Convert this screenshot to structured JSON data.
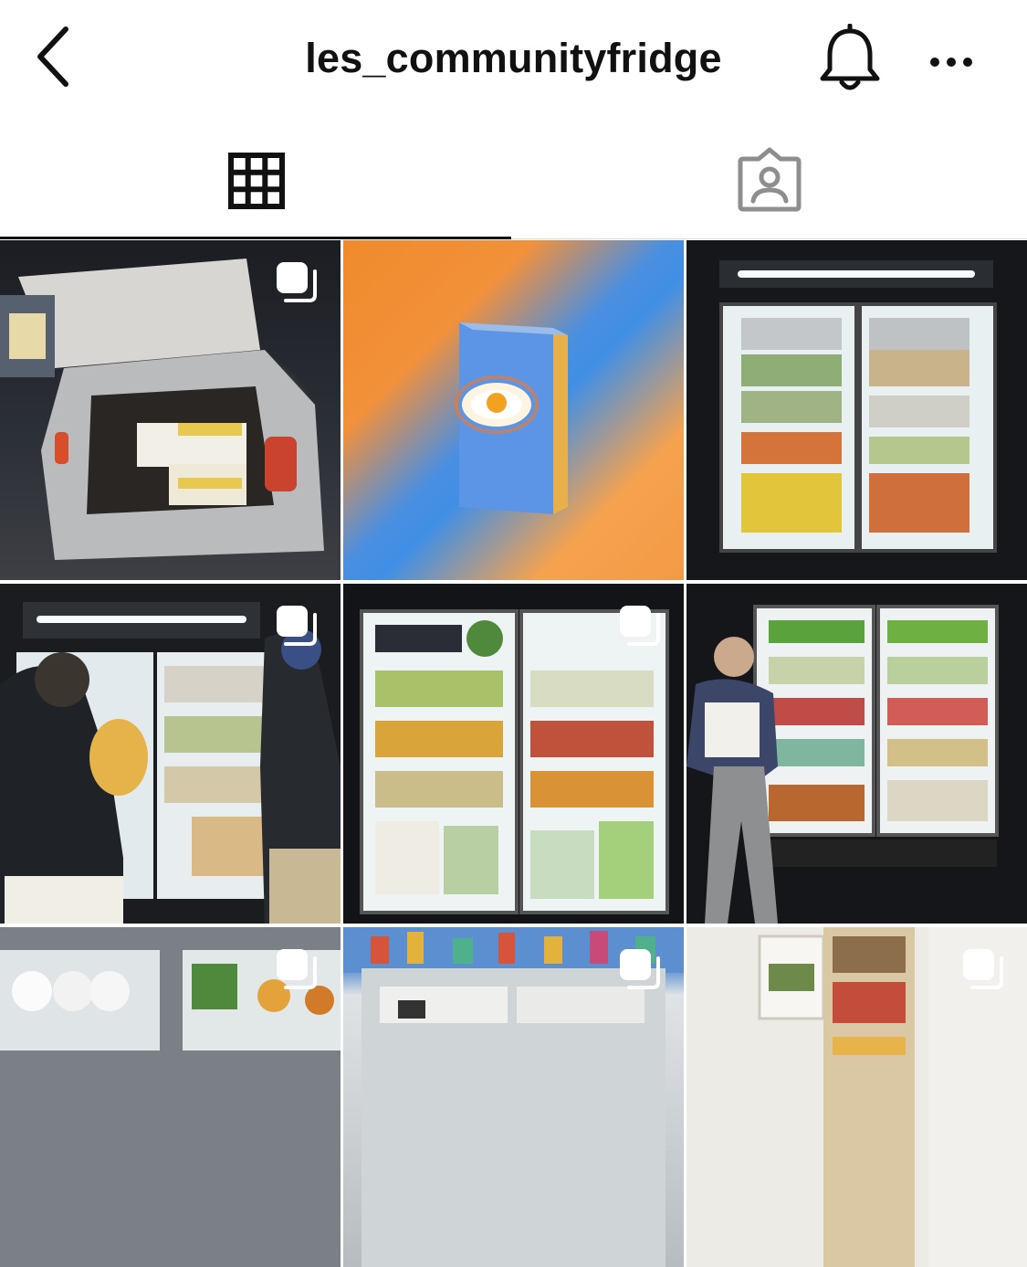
{
  "header": {
    "username": "les_communityfridge",
    "back_icon": "chevron-left-icon",
    "notification_icon": "bell-icon",
    "more_icon": "ellipsis-icon"
  },
  "tabs": [
    {
      "name": "posts",
      "icon": "grid-icon",
      "active": true
    },
    {
      "name": "tagged",
      "icon": "tagged-person-icon",
      "active": false
    }
  ],
  "posts": [
    {
      "subject": "car trunk loaded with banana boxes",
      "multiple": true
    },
    {
      "subject": "book with fried egg cover on gradient",
      "multiple": false
    },
    {
      "subject": "stocked community fridge at night",
      "multiple": false
    },
    {
      "subject": "volunteers with turkey at fridge",
      "multiple": true
    },
    {
      "subject": "fully stocked double-door fridge",
      "multiple": true
    },
    {
      "subject": "volunteer pointing at stocked fridge",
      "multiple": false
    },
    {
      "subject": "fridge with paper towels and produce",
      "multiple": true
    },
    {
      "subject": "fridge under colorful mural",
      "multiple": true
    },
    {
      "subject": "open shelving with produce",
      "multiple": true
    }
  ],
  "colors": {
    "text": "#111111",
    "divider": "#dbdbdb",
    "tab_inactive": "#8e8e8e"
  }
}
